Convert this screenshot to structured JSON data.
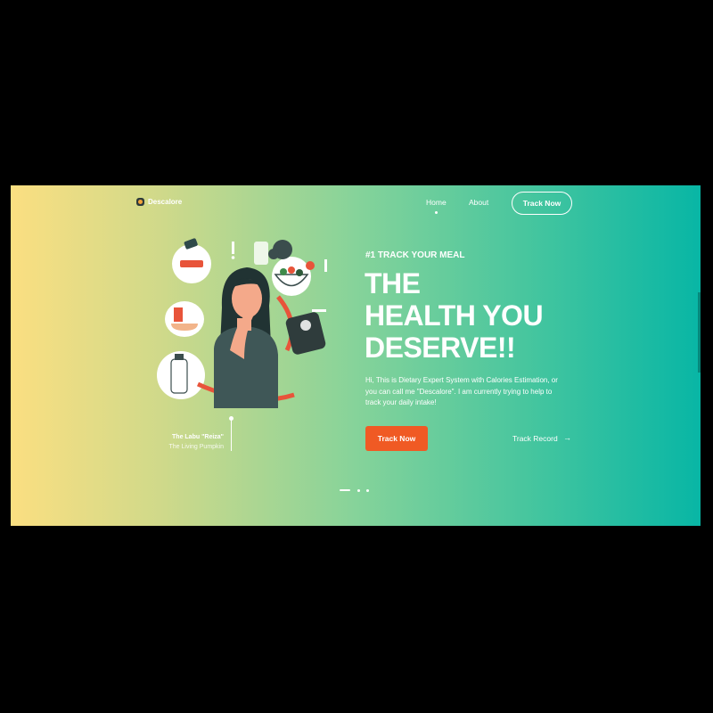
{
  "brand": {
    "name": "Descalore"
  },
  "nav": {
    "home": "Home",
    "about": "About",
    "cta": "Track Now"
  },
  "hero": {
    "eyebrow": "#1 TRACK YOUR MEAL",
    "headline": [
      "THE",
      "HEALTH YOU",
      "DESERVE!!"
    ],
    "description": "Hi, This is Dietary Expert System with Calories Estimation, or you can call me \"Descalore\". I am currently trying to help to track your daily intake!",
    "primary_button": "Track Now",
    "secondary_link": "Track Record",
    "secondary_arrow": "→"
  },
  "author": {
    "name": "The Labu \"Reiza\"",
    "role": "The Living Pumpkin"
  },
  "carousel": {
    "total": 3,
    "active": 1
  },
  "colors": {
    "gradient_start": "#fbdf81",
    "gradient_end": "#08b6a5",
    "cta": "#f05a24",
    "text": "#ffffff"
  }
}
